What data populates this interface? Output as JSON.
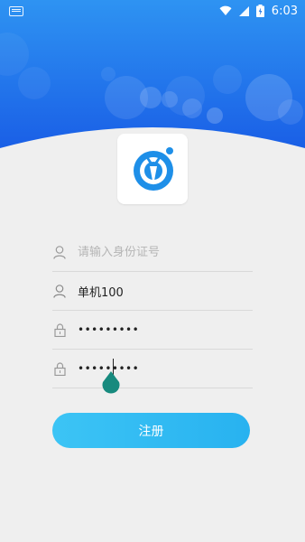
{
  "status_bar": {
    "time": "6:03",
    "icons": [
      "keyboard-icon",
      "wifi-icon",
      "signal-icon",
      "battery-icon"
    ]
  },
  "colors": {
    "hero_top": "#2e8ff0",
    "hero_bottom": "#1a5fe8",
    "button": "#2db7f2",
    "logo_blue": "#1e8fe8"
  },
  "form": {
    "id_number": {
      "placeholder": "请输入身份证号",
      "value": ""
    },
    "username": {
      "value": "单机100"
    },
    "password": {
      "value": "•••••••••"
    },
    "confirm_password": {
      "value": "•••••••••"
    }
  },
  "register_button": {
    "label": "注册"
  }
}
